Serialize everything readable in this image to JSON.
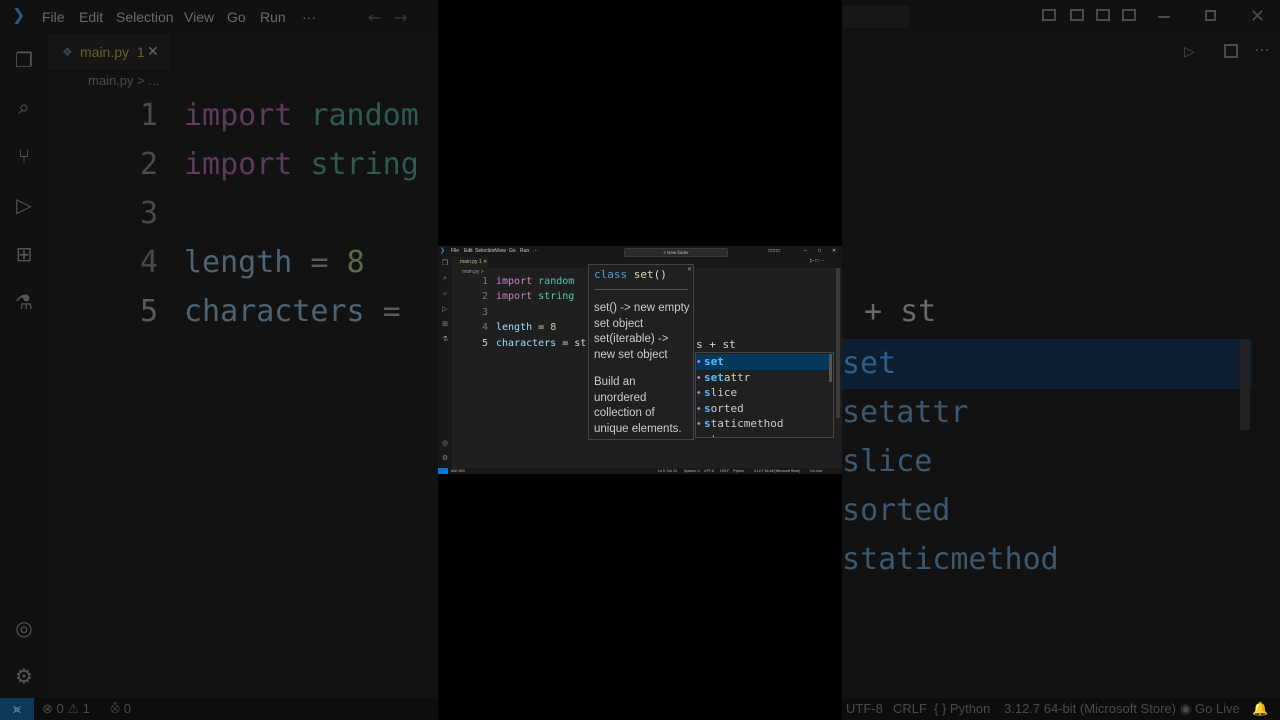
{
  "menu": [
    "File",
    "Edit",
    "Selection",
    "View",
    "Go",
    "Run",
    "···"
  ],
  "tab": {
    "filename": "main.py",
    "problems": "1"
  },
  "breadcrumb": "main.py >",
  "breadcrumb_partial": "main.py > ...",
  "code_lines": [
    {
      "n": "1",
      "kw": "import",
      "rest": "random"
    },
    {
      "n": "2",
      "kw": "import",
      "rest": "string"
    },
    {
      "n": "3",
      "kw": "",
      "rest": ""
    },
    {
      "n": "4",
      "id": "length",
      "op": " = ",
      "num": "8"
    },
    {
      "n": "5",
      "id": "characters",
      "op": " = ",
      "tail": "st"
    }
  ],
  "typed_fragment": "s + st",
  "zoom_typed": "+ st",
  "hover": {
    "sig_keyword": "class",
    "sig_name": "set",
    "sig_parens": "()",
    "doc1": "set() -> new empty set object set(iterable) -> new set object",
    "doc2": "Build an unordered collection of unique elements."
  },
  "suggestions": [
    {
      "match": "set",
      "rest": ""
    },
    {
      "match": "set",
      "rest": "attr"
    },
    {
      "match": "s",
      "rest": "lice"
    },
    {
      "match": "s",
      "rest": "orted"
    },
    {
      "match": "s",
      "rest": "taticmethod"
    },
    {
      "match": "s",
      "rest": "tr"
    }
  ],
  "window_search": "New folder",
  "status": {
    "errors": "0",
    "warnings": "1",
    "ports": "0",
    "position": "Ln 5, Col 23",
    "spaces": "Spaces: 4",
    "encoding": "UTF-8",
    "eol": "CRLF",
    "language": "Python",
    "interpreter": "3.12.7 64-bit (Microsoft Store)",
    "golive": "Go Live"
  },
  "colors": {
    "editor_bg": "#1f1f1f",
    "keyword": "#c586c0",
    "module": "#4ec9b0",
    "variable": "#9cdcfe",
    "number": "#b5cea8",
    "selection": "#04395e",
    "accent": "#0078d4"
  }
}
